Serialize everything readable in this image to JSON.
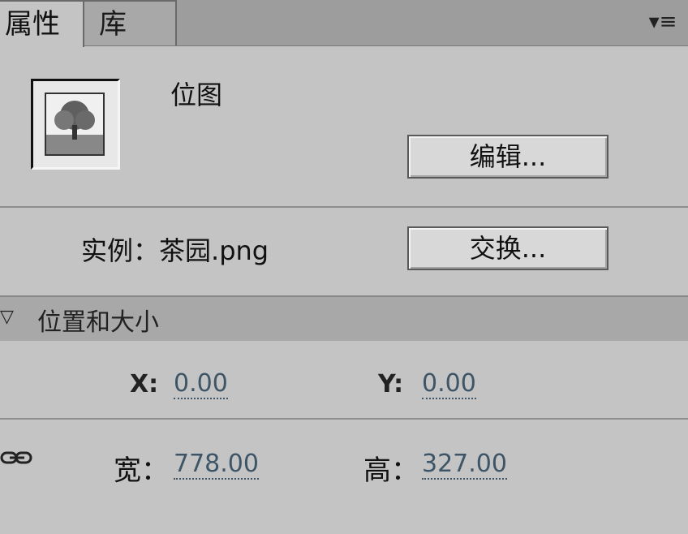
{
  "tabs": [
    {
      "label": "属性",
      "active": true
    },
    {
      "label": "库",
      "active": false
    }
  ],
  "panel_menu_icon": "panel-menu-icon",
  "symbol": {
    "type_label": "位图",
    "thumbnail_icon": "tree-bitmap-icon"
  },
  "buttons": {
    "edit": "编辑...",
    "swap": "交换..."
  },
  "instance": {
    "label": "实例：",
    "name": "茶园.png"
  },
  "position_size": {
    "title": "位置和大小",
    "x_label": "X:",
    "x_value": "0.00",
    "y_label": "Y:",
    "y_value": "0.00",
    "width_label": "宽：",
    "width_value": "778.00",
    "height_label": "高：",
    "height_value": "327.00",
    "lock_icon": "link-lock-icon"
  },
  "colors": {
    "panel_bg": "#c4c4c4",
    "tabbar_bg": "#9d9d9d",
    "value_color": "#3d5566"
  }
}
